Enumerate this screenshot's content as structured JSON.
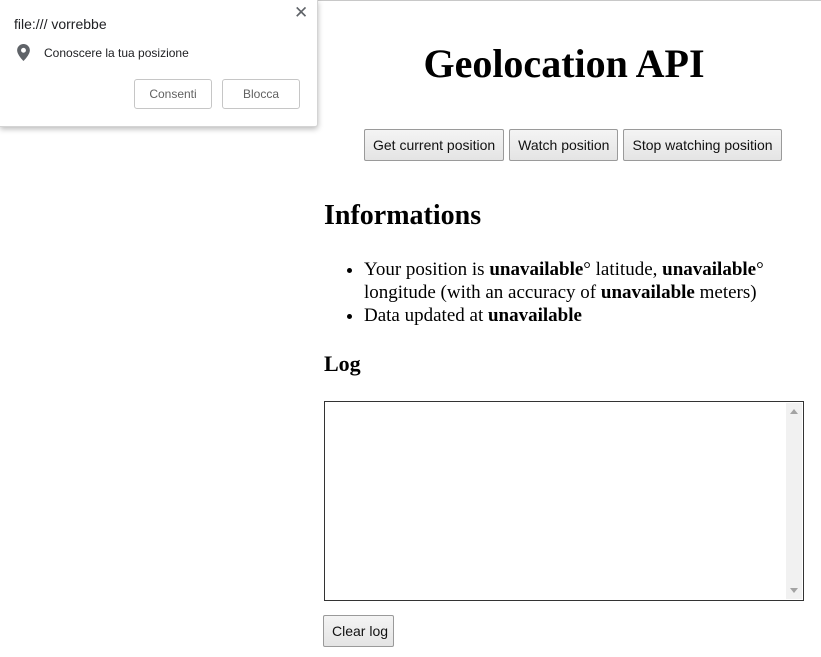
{
  "popup": {
    "origin": "file:/// vorrebbe",
    "request": "Conoscere la tua posizione",
    "allow_label": "Consenti",
    "block_label": "Blocca",
    "close_glyph": "✕",
    "request_icon": "location-pin-icon"
  },
  "page": {
    "title": "Geolocation API",
    "buttons": {
      "get_current": "Get current position",
      "watch": "Watch position",
      "stop_watching": "Stop watching position"
    },
    "informations_heading": "Informations",
    "info": {
      "pos_prefix": "Your position is ",
      "latitude": "unavailable",
      "lat_suffix": "° latitude, ",
      "longitude": "unavailable",
      "lon_suffix": "° longitude (with an accuracy of ",
      "accuracy": "unavailable",
      "acc_suffix": " meters)",
      "updated_prefix": "Data updated at ",
      "updated_at": "unavailable"
    },
    "log_heading": "Log",
    "log_text": "",
    "clear_log_label": "Clear log"
  },
  "colors": {
    "popup_text": "#202124",
    "popup_button_text": "#616161",
    "button_border": "#9a9a9a"
  }
}
